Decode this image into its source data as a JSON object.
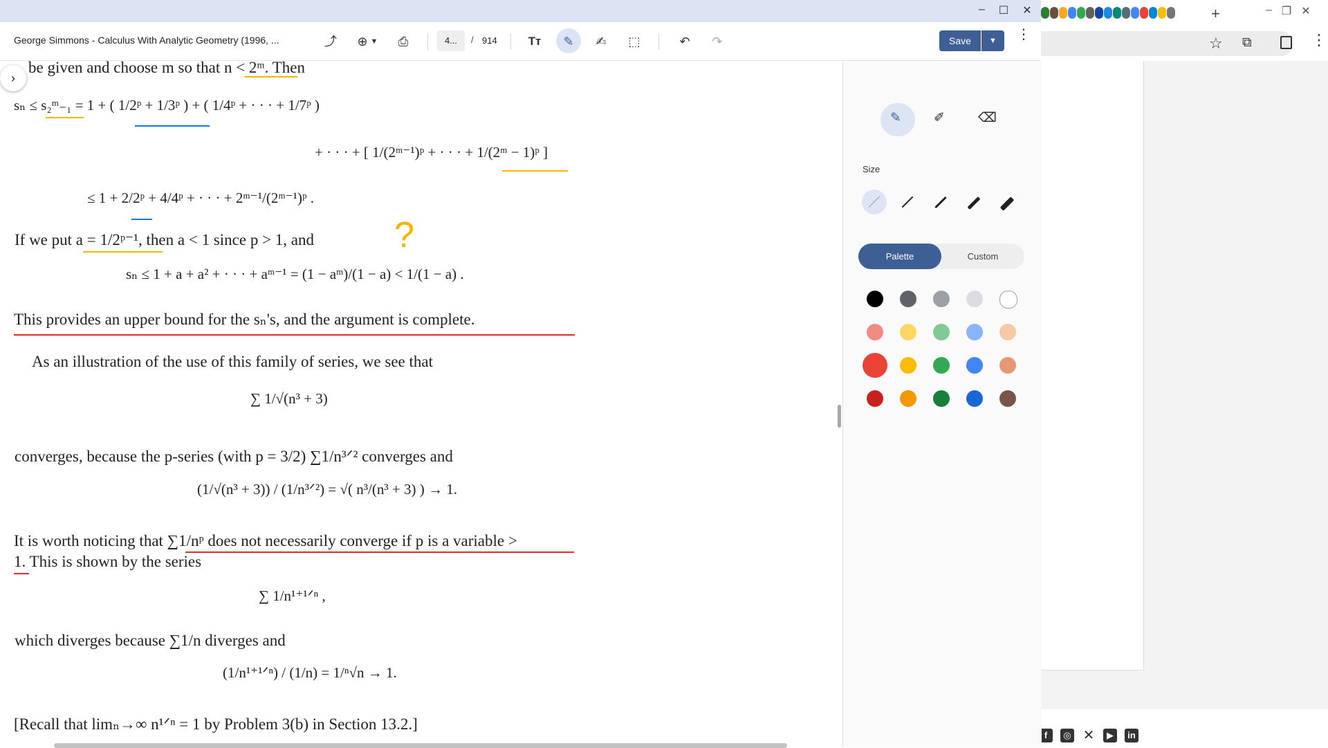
{
  "pdf_window": {
    "title": "George Simmons - Calculus With Analytic Geometry (1996, ...",
    "page_current": "4...",
    "page_separator": "/",
    "page_total": "914",
    "save_label": "Save",
    "icons": [
      "share-icon",
      "zoom-icon",
      "print-icon",
      "text-icon",
      "annotate-icon",
      "signature-icon",
      "select-icon",
      "undo-icon",
      "redo-icon",
      "more-icon"
    ]
  },
  "document": {
    "line1": "be given and choose m so that n < 2ᵐ. Then",
    "eq1": "sₙ ≤ s₂ᵐ₋₁ = 1 + ( 1/2ᵖ + 1/3ᵖ ) + ( 1/4ᵖ + · · · + 1/7ᵖ )",
    "eq2": "+ · · · + [ 1/(2ᵐ⁻¹)ᵖ + · · · + 1/(2ᵐ − 1)ᵖ ]",
    "eq3": "≤ 1 + 2/2ᵖ + 4/4ᵖ + · · · + 2ᵐ⁻¹/(2ᵐ⁻¹)ᵖ .",
    "line2": "If we put a = 1/2ᵖ⁻¹, then a < 1 since p > 1, and",
    "eq4": "sₙ ≤ 1 + a + a² + · · · + aᵐ⁻¹ = (1 − aᵐ)/(1 − a) < 1/(1 − a) .",
    "line3": "This provides an upper bound for the sₙ's, and the argument is complete.",
    "line4": "As an illustration of the use of this family of series, we see that",
    "eq5": "∑ 1/√(n³ + 3)",
    "line5": "converges, because the p-series (with p = 3/2) ∑1/n³ᐟ² converges and",
    "eq6": "(1/√(n³ + 3)) / (1/n³ᐟ²) = √( n³/(n³ + 3) ) → 1.",
    "line6": "It is worth noticing that ∑1/nᵖ does not necessarily converge if p is a variable >",
    "line7": "1. This is shown by the series",
    "eq7": "∑ 1/n¹⁺¹ᐟⁿ ,",
    "line8": "which diverges because ∑1/n diverges and",
    "eq8": "(1/n¹⁺¹ᐟⁿ) / (1/n) = 1/ⁿ√n → 1.",
    "line9": "[Recall that limₙ→∞ n¹ᐟⁿ = 1 by Problem 3(b) in Section 13.2.]",
    "annotation_mark": "?"
  },
  "panel": {
    "size_label": "Size",
    "tab_palette": "Palette",
    "tab_custom": "Custom",
    "colors": [
      [
        "#000000",
        "#5f6368",
        "#9aa0a6",
        "#dadce0",
        "#ffffff"
      ],
      [
        "#f28b82",
        "#fdd663",
        "#81c995",
        "#8ab4f8",
        "#f6c9a7"
      ],
      [
        "#ea4335",
        "#fbbc04",
        "#34a853",
        "#4285f4",
        "#e49874"
      ],
      [
        "#c5221f",
        "#f29900",
        "#188038",
        "#1967d2",
        "#795548"
      ]
    ],
    "selected_color": "#ea4335"
  },
  "colors": {
    "accent": "#3e5f95",
    "ink_yellow": "#f4b400",
    "ink_blue": "#1a73e8",
    "ink_red": "#d93025"
  }
}
